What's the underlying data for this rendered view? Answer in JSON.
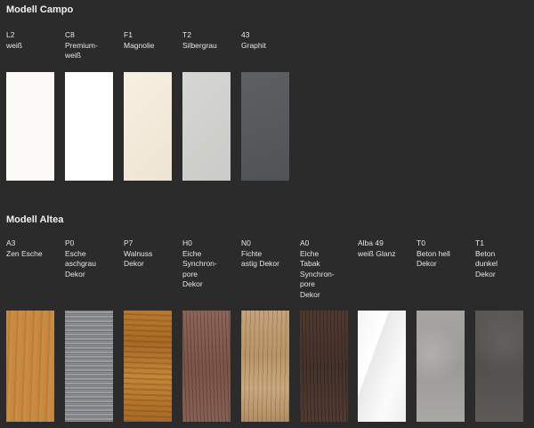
{
  "sections": {
    "campo": {
      "title": "Modell Campo",
      "items": [
        {
          "code": "L2",
          "name": "weiß"
        },
        {
          "code": "C8",
          "name": "Premium-\nweiß"
        },
        {
          "code": "F1",
          "name": "Magnolie"
        },
        {
          "code": "T2",
          "name": "Silbergrau"
        },
        {
          "code": "43",
          "name": "Graphit"
        }
      ]
    },
    "altea": {
      "title": "Modell Altea",
      "items": [
        {
          "code": "A3",
          "name": "Zen Esche"
        },
        {
          "code": "P0",
          "name": "Esche\naschgrau\nDekor"
        },
        {
          "code": "P7",
          "name": "Walnuss\nDekor"
        },
        {
          "code": "H0",
          "name": "Eiche\nSynchron-\npore\nDekor"
        },
        {
          "code": "N0",
          "name": "Fichte\nastig Dekor"
        },
        {
          "code": "A0",
          "name": "Eiche\nTabak\nSynchron-\npore\nDekor"
        },
        {
          "code": "Alba 49",
          "name": "weiß Glanz"
        },
        {
          "code": "T0",
          "name": "Beton hell\nDekor"
        },
        {
          "code": "T1",
          "name": "Beton\ndunkel\nDekor"
        }
      ]
    }
  },
  "colors": {
    "background": "#2b2b2b",
    "text": "#e6e6e6"
  }
}
